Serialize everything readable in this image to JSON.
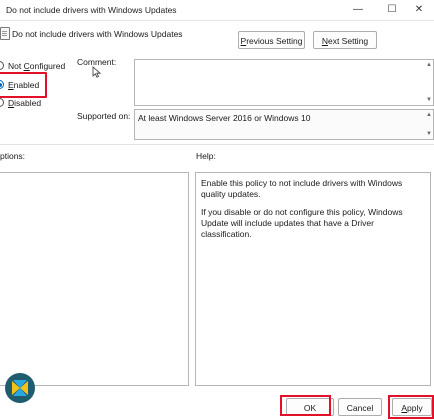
{
  "window": {
    "title": "Do not include drivers with Windows Updates",
    "controls": {
      "minimize": "—",
      "maximize": "☐",
      "close": "✕"
    }
  },
  "policy": {
    "name": "Do not include drivers with Windows Updates"
  },
  "nav": {
    "previous_prefix": "P",
    "previous_rest": "revious Setting",
    "next_prefix": "N",
    "next_rest": "ext Setting"
  },
  "state": {
    "options": [
      {
        "prefix": "Not ",
        "key": "C",
        "rest": "onfigured",
        "checked": false
      },
      {
        "prefix": "",
        "key": "E",
        "rest": "nabled",
        "checked": true
      },
      {
        "prefix": "",
        "key": "D",
        "rest": "isabled",
        "checked": false
      }
    ]
  },
  "comment": {
    "label": "Comment:",
    "value": ""
  },
  "supported": {
    "label": "Supported on:",
    "value": "At least Windows Server 2016 or Windows 10"
  },
  "options_pane": {
    "label": "ptions:"
  },
  "help_pane": {
    "label": "Help:",
    "paragraph1": "Enable this policy to not include drivers with Windows quality updates.",
    "paragraph2": "If you disable or do not configure this policy, Windows Update will include updates that have a Driver classification."
  },
  "footer": {
    "ok": "OK",
    "cancel": "Cancel",
    "apply_prefix": "A",
    "apply_rest": "pply"
  },
  "colors": {
    "accent": "#0067c0",
    "highlight": "#e3102a"
  },
  "icons": [
    "policy-icon",
    "cursor-icon",
    "app-logo-icon"
  ]
}
